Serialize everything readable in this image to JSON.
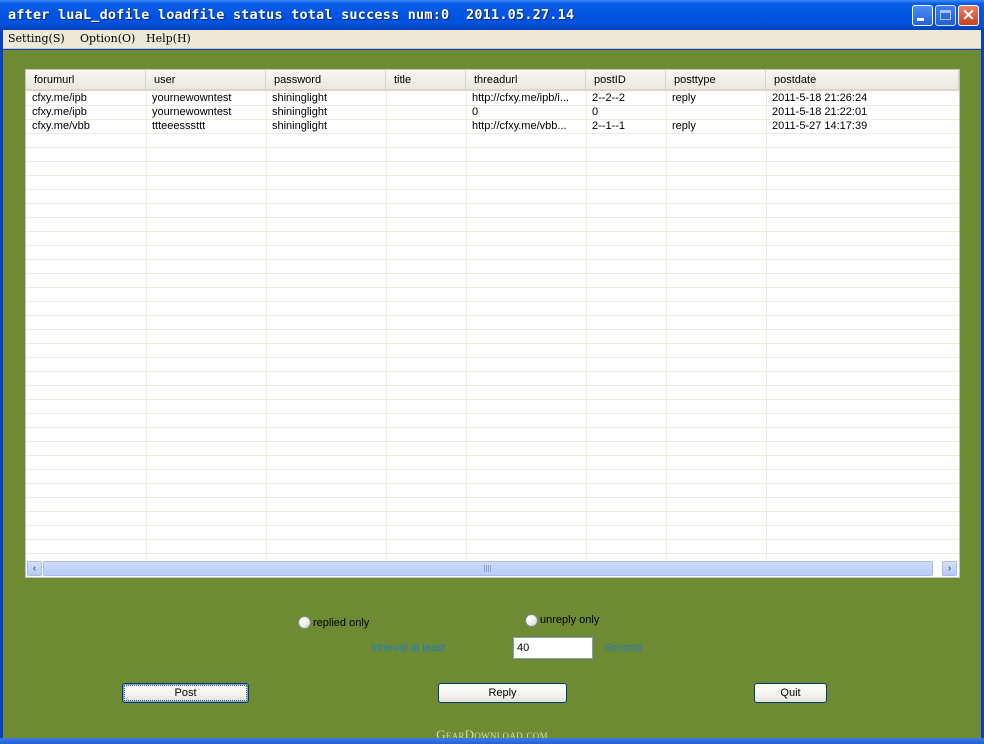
{
  "window": {
    "title": "after luaL_dofile loadfile status total success num:0  2011.05.27.14",
    "controls": {
      "minimize": "minimize",
      "maximize": "maximize",
      "close": "×"
    }
  },
  "menu": {
    "items": [
      {
        "label": "Setting(S)"
      },
      {
        "label": "Option(O)"
      },
      {
        "label": "Help(H)"
      }
    ]
  },
  "table": {
    "columns": [
      "forumurl",
      "user",
      "password",
      "title",
      "threadurl",
      "postID",
      "posttype",
      "postdate"
    ],
    "rows": [
      [
        "cfxy.me/ipb",
        "yournewowntest",
        "shininglight",
        "",
        "http://cfxy.me/ipb/i...",
        "2--2--2",
        "reply",
        "2011-5-18 21:26:24"
      ],
      [
        "cfxy.me/ipb",
        "yournewowntest",
        "shininglight",
        "",
        "0",
        "0",
        "",
        "2011-5-18 21:22:01"
      ],
      [
        "cfxy.me/vbb",
        "ttteeesssttt",
        "shininglight",
        "",
        "http://cfxy.me/vbb...",
        "2--1--1",
        "reply",
        "2011-5-27 14:17:39"
      ]
    ],
    "scroll_left_glyph": "‹",
    "scroll_right_glyph": "›"
  },
  "options": {
    "replied_only": "replied only",
    "unreply_only": "unreply only",
    "interval_label": "Interval at least",
    "interval_value": "40",
    "interval_unit": "Second"
  },
  "buttons": {
    "post": "Post",
    "reply": "Reply",
    "quit": "Quit"
  },
  "watermark": "GearDownload.com"
}
